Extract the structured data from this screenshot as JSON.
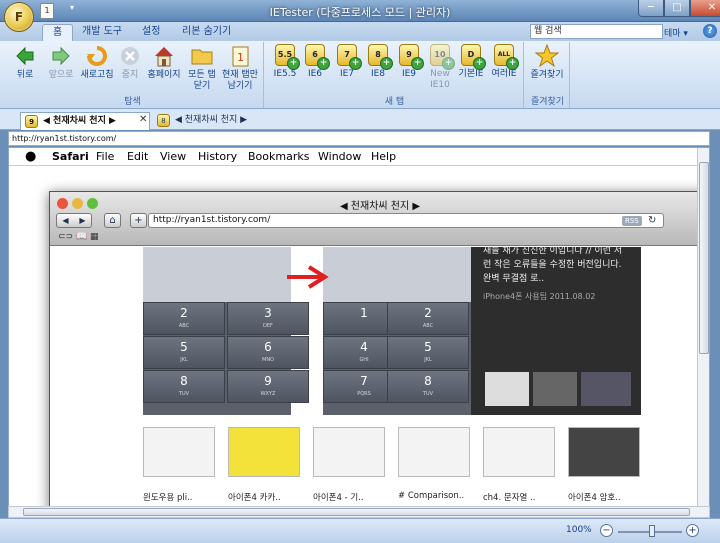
{
  "window": {
    "title": "IETester (다중프로세스 모드 | 관리자)",
    "min": "─",
    "max": "□",
    "close": "✕"
  },
  "orb": "F",
  "qat": {
    "doc_icon": "1",
    "dropdown": "▾"
  },
  "ribbon_tabs": [
    "홈",
    "개발 도구",
    "설정",
    "리본 숨기기"
  ],
  "search": {
    "value": "웹 검색",
    "theme": "테마 ▾",
    "help": "?"
  },
  "groups": {
    "nav": {
      "label": "탐색",
      "buttons": [
        "뒤로",
        "앞으로",
        "새로고침",
        "중지",
        "홈페이지",
        "모든 탭 닫기",
        "현재 탭만 남기기"
      ]
    },
    "newtab": {
      "label": "새 탭",
      "buttons": [
        "IE5.5",
        "IE6",
        "IE7",
        "IE8",
        "IE9",
        "New IE10",
        "기본IE",
        "여러IE"
      ],
      "icons": [
        "5.5",
        "6",
        "7",
        "8",
        "9",
        "10",
        "D",
        "ALL"
      ]
    },
    "fav": {
      "label": "즐겨찾기",
      "button": "즐겨찾기"
    }
  },
  "doc_tabs": [
    {
      "label": "◀ 천재차씨 천지 ▶",
      "icon": "9",
      "close": "✕"
    },
    {
      "label": "◀ 천재차씨 천지 ▶",
      "icon": "8"
    }
  ],
  "address": "http://ryan1st.tistory.com/",
  "mac_menu": [
    "",
    "Safari",
    "File",
    "Edit",
    "View",
    "History",
    "Bookmarks",
    "Window",
    "Help"
  ],
  "safari": {
    "title": "◀ 천재차씨 천지 ▶",
    "url": "http://ryan1st.tistory.com/",
    "rss": "RSS",
    "nav": [
      "◀",
      "▶"
    ],
    "bookmarks": "⊂⊃  📖  ▦",
    "post_text": "새들 채가 진진한 이입니다 // 이런 저런 작은 오류들을 수정한 버전입니다. 완벽 무결점 로..",
    "post_meta": "iPhone4폰 사용팁   2011.08.02",
    "keys": [
      [
        "2",
        "ABC"
      ],
      [
        "3",
        "DEF"
      ],
      [
        "1",
        ""
      ],
      [
        "2",
        "ABC"
      ],
      [
        "5",
        "JKL"
      ],
      [
        "6",
        "MNO"
      ],
      [
        "4",
        "GHI"
      ],
      [
        "5",
        "JKL"
      ],
      [
        "8",
        "TUV"
      ],
      [
        "9",
        "WXYZ"
      ],
      [
        "7",
        "PQRS"
      ],
      [
        "8",
        "TUV"
      ]
    ],
    "thumb_captions": [
      "윈도우용 pli..",
      "아이폰4 카카..",
      "아이폰4 - 기..",
      "# Comparison..",
      "ch4. 문자열 ..",
      "아이폰4 암호.."
    ]
  },
  "status": {
    "zoom": "100%",
    "zoom_out": "−",
    "zoom_in": "+"
  },
  "colors": {
    "accent": "#15428b",
    "ribbon": "#d4e3f4",
    "title_bar": "#5d86b6"
  }
}
